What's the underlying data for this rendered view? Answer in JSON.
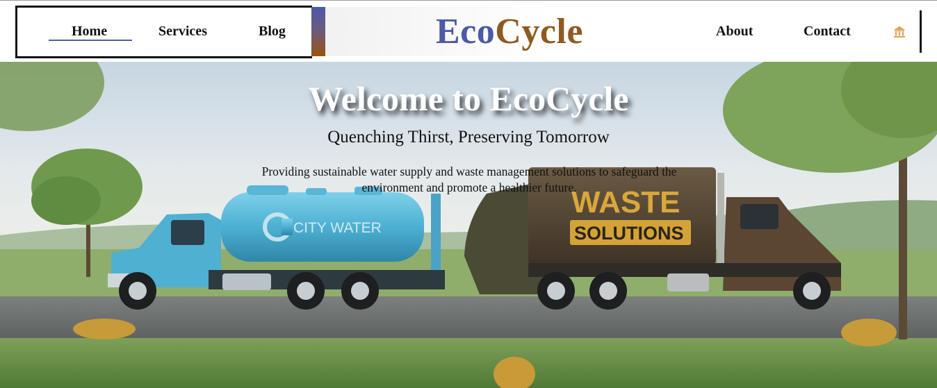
{
  "header": {
    "brand_part1": "Eco",
    "brand_part2": "Cycle",
    "nav_left": {
      "home": "Home",
      "services": "Services",
      "blog": "Blog"
    },
    "nav_right": {
      "about": "About",
      "contact": "Contact"
    },
    "active_item": "Home",
    "icon": "building-icon"
  },
  "hero": {
    "title": "Welcome to EcoCycle",
    "subtitle": "Quenching Thirst, Preserving Tomorrow",
    "description": "Providing sustainable water supply and waste management solutions to safeguard the environment and promote a healthier future.",
    "image": {
      "water_truck_label": "CITY WATER",
      "waste_truck_label_line1": "WASTE",
      "waste_truck_label_line2": "SOLUTIONS"
    }
  },
  "colors": {
    "brand_blue": "#4a5aa6",
    "brand_brown": "#8f5a22",
    "water_truck": "#4fb3d4",
    "waste_truck": "#5a4a36",
    "waste_sign": "#d9a83a"
  }
}
